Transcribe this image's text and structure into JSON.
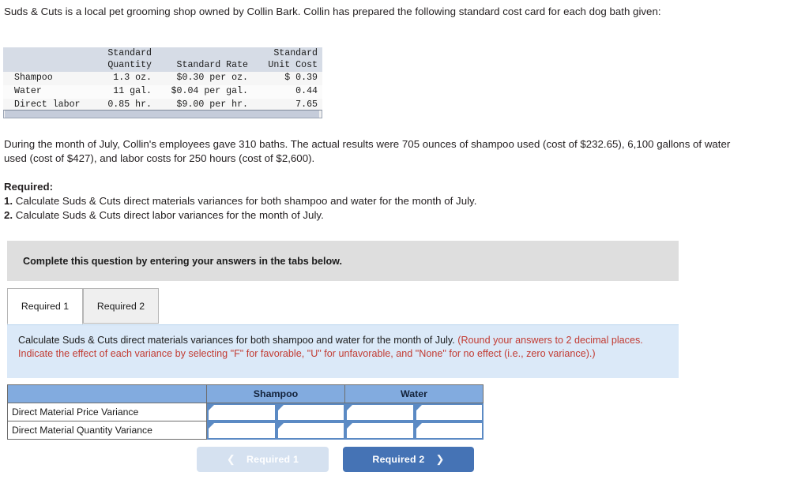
{
  "intro": "Suds & Cuts is a local pet grooming shop owned by Collin Bark. Collin has prepared the following standard cost card for each dog bath given:",
  "cost_card": {
    "headers": [
      "",
      "Standard\nQuantity",
      "Standard Rate",
      "Standard\nUnit Cost"
    ],
    "rows": [
      {
        "item": "Shampoo",
        "quantity": "1.3 oz.",
        "rate": "$0.30 per oz.",
        "unit_cost": "$ 0.39"
      },
      {
        "item": "Water",
        "quantity": "11 gal.",
        "rate": "$0.04 per gal.",
        "unit_cost": "0.44"
      },
      {
        "item": "Direct labor",
        "quantity": "0.85 hr.",
        "rate": "$9.00 per hr.",
        "unit_cost": "7.65"
      }
    ]
  },
  "actual_results": "During the month of July, Collin's employees gave 310 baths. The actual results were 705 ounces of shampoo used (cost of $232.65), 6,100 gallons of water used (cost of $427), and labor costs for 250 hours (cost of $2,600).",
  "required": {
    "heading": "Required:",
    "items": [
      {
        "num": "1.",
        "text": " Calculate Suds & Cuts direct materials variances for both shampoo and water for the month of July."
      },
      {
        "num": "2.",
        "text": " Calculate Suds & Cuts direct labor variances for the month of July."
      }
    ]
  },
  "callout": "Complete this question by entering your answers in the tabs below.",
  "tabs": [
    {
      "label": "Required 1",
      "active": true
    },
    {
      "label": "Required 2",
      "active": false
    }
  ],
  "instruction": {
    "black": "Calculate Suds & Cuts direct materials variances for both shampoo and water for the month of July. ",
    "red": "(Round your answers to 2 decimal places. Indicate the effect of each variance by selecting \"F\" for favorable, \"U\" for unfavorable, and \"None\" for no effect (i.e., zero variance).)"
  },
  "answer_table": {
    "headers": [
      "",
      "Shampoo",
      "Water"
    ],
    "rows": [
      {
        "label": "Direct Material Price Variance",
        "shampoo_amount": "",
        "shampoo_effect": "",
        "water_amount": "",
        "water_effect": ""
      },
      {
        "label": "Direct Material Quantity Variance",
        "shampoo_amount": "",
        "shampoo_effect": "",
        "water_amount": "",
        "water_effect": ""
      }
    ]
  },
  "nav": {
    "prev_label": "Required 1",
    "next_label": "Required 2",
    "prev_icon": "chevron-left",
    "next_icon": "chevron-right"
  },
  "colors": {
    "header_blue": "#82abdf",
    "panel_blue": "#dbe9f8",
    "callout_gray": "#dedede",
    "button_blue": "#4573b5",
    "button_disabled": "#d5e1f0",
    "red_text": "#c23b32",
    "cost_header": "#d6dce6"
  }
}
